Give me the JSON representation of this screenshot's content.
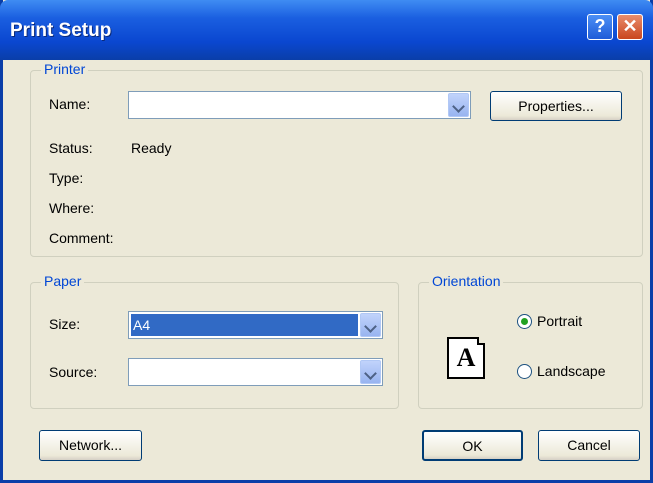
{
  "window": {
    "title": "Print Setup",
    "help_glyph": "?",
    "close_glyph": "✕"
  },
  "printer": {
    "legend": "Printer",
    "name_label": "Name:",
    "name_value": "",
    "properties_button": "Properties...",
    "status_label": "Status:",
    "status_value": "Ready",
    "type_label": "Type:",
    "where_label": "Where:",
    "comment_label": "Comment:"
  },
  "paper": {
    "legend": "Paper",
    "size_label": "Size:",
    "size_value": "A4",
    "source_label": "Source:",
    "source_value": ""
  },
  "orientation": {
    "legend": "Orientation",
    "page_glyph": "A",
    "portrait_label": "Portrait",
    "landscape_label": "Landscape",
    "selected": "Portrait"
  },
  "buttons": {
    "network": "Network...",
    "ok": "OK",
    "cancel": "Cancel"
  },
  "icons": {
    "help": "help-icon",
    "close": "close-icon",
    "dropdown": "chevron-down-icon",
    "page": "portrait-page-icon"
  },
  "colors": {
    "titlebar": "#0a47d0",
    "dialog_bg": "#ece9d8",
    "group_label": "#0046d5",
    "selection": "#316ac5",
    "radio_dot": "#21a121"
  }
}
